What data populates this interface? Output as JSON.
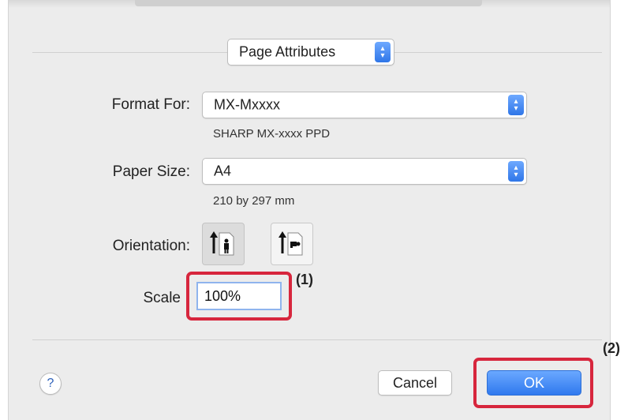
{
  "dialog": {
    "section_popup": "Page Attributes"
  },
  "format_for": {
    "label": "Format For:",
    "value": "MX-Mxxxx",
    "detail": "SHARP MX-xxxx PPD"
  },
  "paper_size": {
    "label": "Paper Size:",
    "value": "A4",
    "detail": "210 by 297 mm"
  },
  "orientation": {
    "label": "Orientation:",
    "selected": "portrait"
  },
  "scale": {
    "label": "Scale",
    "value": "100%"
  },
  "callouts": {
    "one": "(1)",
    "two": "(2)"
  },
  "buttons": {
    "help": "?",
    "cancel": "Cancel",
    "ok": "OK"
  },
  "colors": {
    "accent": "#3079ee",
    "callout": "#d7263d"
  }
}
